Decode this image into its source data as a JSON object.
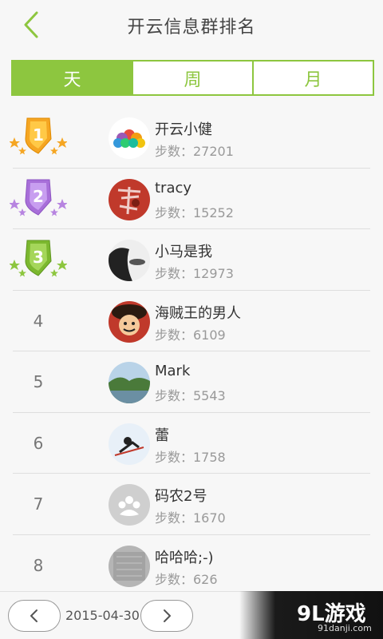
{
  "header": {
    "title": "开云信息群排名"
  },
  "tabs": [
    {
      "label": "天",
      "active": true
    },
    {
      "label": "周",
      "active": false
    },
    {
      "label": "月",
      "active": false
    }
  ],
  "steps_prefix": "步数：",
  "ranking": [
    {
      "rank": "1",
      "badge": "gold",
      "name": "开云小健",
      "steps": "步数：27201",
      "avatar": "colorful-flower"
    },
    {
      "rank": "2",
      "badge": "purple",
      "name": "tracy",
      "steps": "步数：15252",
      "avatar": "red-character"
    },
    {
      "rank": "3",
      "badge": "green",
      "name": "小马是我",
      "steps": "步数：12973",
      "avatar": "bw-portrait"
    },
    {
      "rank": "4",
      "badge": null,
      "name": "海贼王的男人",
      "steps": "步数：6109",
      "avatar": "anime"
    },
    {
      "rank": "5",
      "badge": null,
      "name": "Mark",
      "steps": "步数：5543",
      "avatar": "landscape"
    },
    {
      "rank": "6",
      "badge": null,
      "name": "蕾",
      "steps": "步数：1758",
      "avatar": "snow-skier"
    },
    {
      "rank": "7",
      "badge": null,
      "name": "码农2号",
      "steps": "步数：1670",
      "avatar": "default-paw"
    },
    {
      "rank": "8",
      "badge": null,
      "name": "哈哈哈;-)",
      "steps": "步数：626",
      "avatar": "gray-texture"
    }
  ],
  "footer": {
    "date": "2015-04-30"
  },
  "watermark": {
    "logo": "9L游戏",
    "url": "91danji.com"
  },
  "colors": {
    "accent": "#8dc63f",
    "gold": "#f5a623",
    "purple": "#b784e0",
    "green": "#8dc63f"
  }
}
